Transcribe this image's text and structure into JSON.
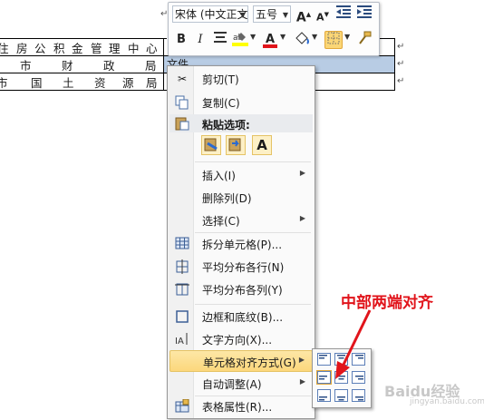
{
  "document": {
    "rows": [
      [
        "住",
        "房",
        "公",
        "积",
        "金",
        "管",
        "理",
        "中",
        "心"
      ],
      [
        "市",
        "",
        "财",
        "",
        "政",
        "",
        "局"
      ],
      [
        "市",
        "国",
        "土",
        "资",
        "源",
        "局"
      ]
    ],
    "selected_cell_text": "文件"
  },
  "mini_toolbar": {
    "font_name": "宋体 (中文正文",
    "font_size": "五号",
    "grow_icon": "A",
    "shrink_icon": "A",
    "bold": "B",
    "italic": "I",
    "font_color_letter": "A"
  },
  "context_menu": {
    "items": [
      {
        "label": "剪切(T)",
        "icon": "scissors-icon"
      },
      {
        "label": "复制(C)",
        "icon": "copy-icon"
      },
      {
        "label": "粘贴选项:",
        "icon": "paste-icon"
      },
      {
        "label": "插入(I)",
        "icon": ""
      },
      {
        "label": "删除列(D)",
        "icon": ""
      },
      {
        "label": "选择(C)",
        "icon": ""
      },
      {
        "label": "拆分单元格(P)...",
        "icon": "split-cells-icon"
      },
      {
        "label": "平均分布各行(N)",
        "icon": "distribute-rows-icon"
      },
      {
        "label": "平均分布各列(Y)",
        "icon": "distribute-columns-icon"
      },
      {
        "label": "边框和底纹(B)...",
        "icon": "borders-icon"
      },
      {
        "label": "文字方向(X)...",
        "icon": "text-direction-icon"
      },
      {
        "label": "单元格对齐方式(G)",
        "icon": ""
      },
      {
        "label": "自动调整(A)",
        "icon": ""
      },
      {
        "label": "表格属性(R)...",
        "icon": "table-properties-icon"
      }
    ],
    "paste_keep_text": "A"
  },
  "annotation": {
    "text": "中部两端对齐",
    "color": "#e1141b"
  },
  "watermark": {
    "text": "Baidu经验",
    "sub": "jingyan.baidu.com"
  },
  "colors": {
    "highlight": "#fcd77c",
    "selection": "#b8cce4",
    "accent": "#e1141b"
  }
}
